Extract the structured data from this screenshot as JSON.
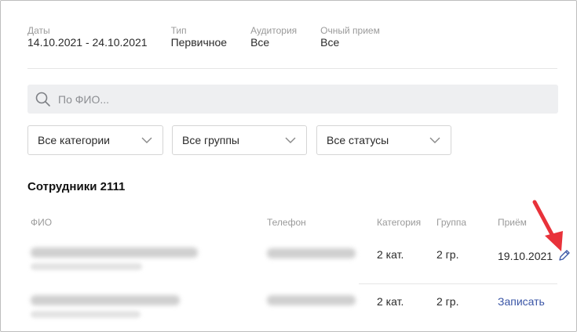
{
  "summary": {
    "dates": {
      "label": "Даты",
      "value": "14.10.2021 - 24.10.2021"
    },
    "type": {
      "label": "Тип",
      "value": "Первичное"
    },
    "audience": {
      "label": "Аудитория",
      "value": "Все"
    },
    "in_person": {
      "label": "Очный прием",
      "value": "Все"
    }
  },
  "search": {
    "placeholder": "По ФИО..."
  },
  "filters": {
    "categories": "Все категории",
    "groups": "Все группы",
    "statuses": "Все статусы"
  },
  "section": {
    "title": "Сотрудники 2111"
  },
  "table": {
    "headers": {
      "name": "ФИО",
      "phone": "Телефон",
      "category": "Категория",
      "group": "Группа",
      "reception": "Приём"
    },
    "rows": [
      {
        "category": "2 кат.",
        "group": "2 гр.",
        "reception": "19.10.2021"
      },
      {
        "category": "2 кат.",
        "group": "2 гр.",
        "reception_action": "Записать"
      }
    ]
  },
  "colors": {
    "accent_link": "#3a55a6",
    "annotation_arrow": "#e8323a",
    "search_bg": "#eeeff1"
  }
}
